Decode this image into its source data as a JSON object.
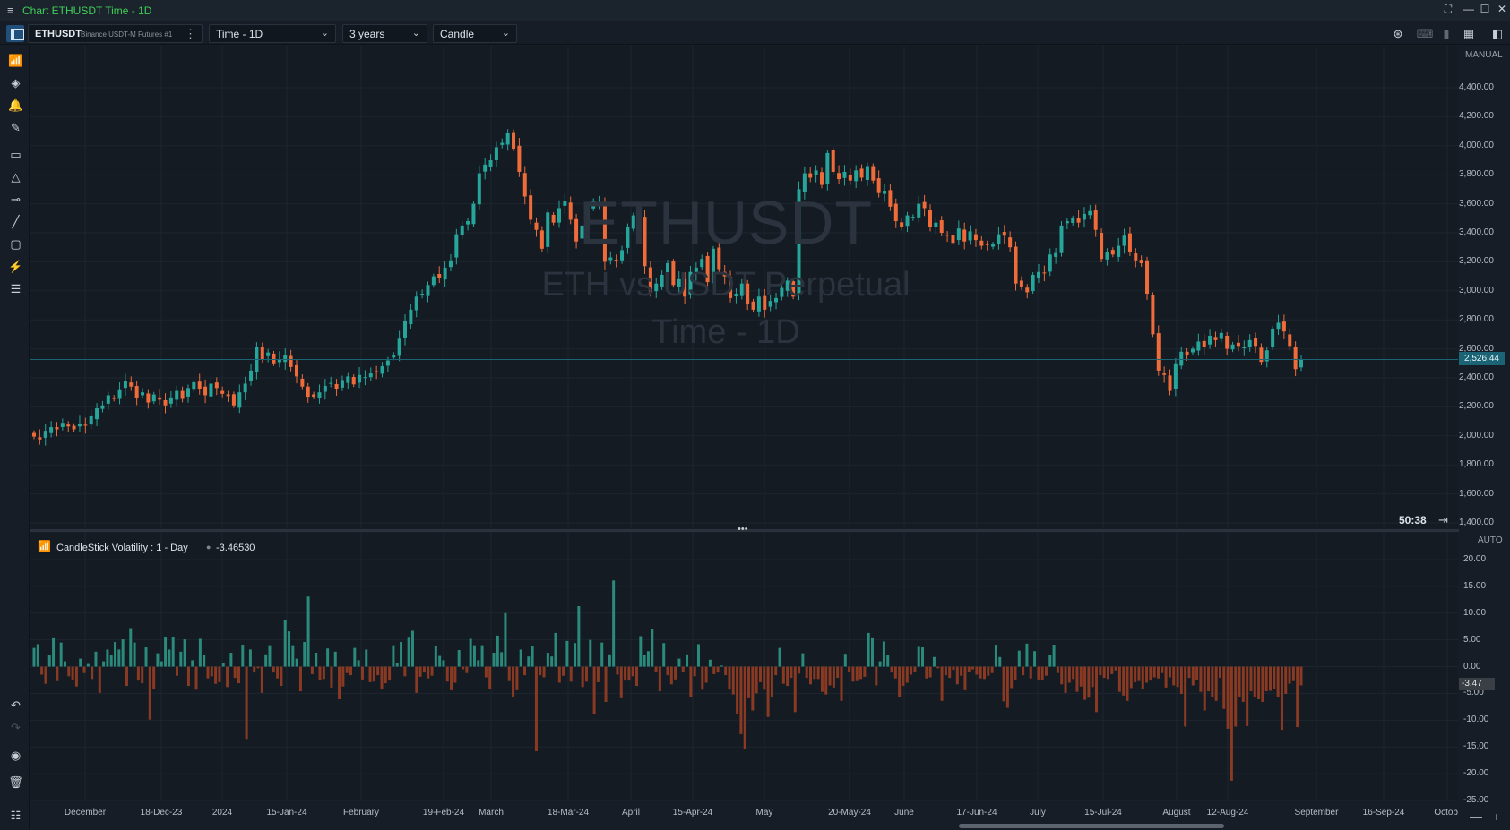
{
  "window": {
    "menu_icon": "hamburger-icon",
    "title": "Chart ETHUSDT Time - 1D",
    "buttons": [
      "fullscreen-icon",
      "minimize-icon",
      "maximize-icon",
      "close-icon"
    ]
  },
  "toolbar": {
    "symbol": "ETHUSDT",
    "exchange": "Binance USDT-M Futures #1",
    "timeframe": "Time - 1D",
    "range": "3 years",
    "chart_type": "Candle"
  },
  "watermark": {
    "symbol": "ETHUSDT",
    "description": "ETH vs USDT Perpetual",
    "timeframe": "Time - 1D"
  },
  "price_axis": {
    "mode": "MANUAL",
    "labels": [
      "4,400.00",
      "4,200.00",
      "4,000.00",
      "3,800.00",
      "3,600.00",
      "3,400.00",
      "3,200.00",
      "3,000.00",
      "2,800.00",
      "2,600.00",
      "2,400.00",
      "2,200.00",
      "2,000.00",
      "1,800.00",
      "1,600.00",
      "1,400.00"
    ],
    "current_price": "2,526.44",
    "countdown": "50:38"
  },
  "indicator": {
    "name": "CandleStick Volatility : 1 - Day",
    "value": "-3.46530",
    "axis_mode": "AUTO",
    "axis_labels": [
      "20.00",
      "15.00",
      "10.00",
      "5.00",
      "0.00",
      "-5.00",
      "-10.00",
      "-15.00",
      "-20.00",
      "-25.00"
    ],
    "current_value": "-3.47"
  },
  "time_axis": {
    "labels": [
      "December",
      "18-Dec-23",
      "2024",
      "15-Jan-24",
      "February",
      "19-Feb-24",
      "March",
      "18-Mar-24",
      "April",
      "15-Apr-24",
      "May",
      "20-May-24",
      "June",
      "17-Jun-24",
      "July",
      "15-Jul-24",
      "August",
      "12-Aug-24",
      "September",
      "16-Sep-24",
      "Octob"
    ]
  },
  "colors": {
    "background": "#141b23",
    "grid": "#1c252f",
    "up": "#26a69a",
    "down": "#ef6c3a",
    "vol_up": "#2a8a7c",
    "vol_down": "#8a3a22",
    "price_line": "#1b6476"
  },
  "chart_data": [
    {
      "type": "candlestick",
      "title": "ETHUSDT",
      "ylim": [
        1400,
        4400
      ],
      "series": [
        {
          "name": "ETHUSDT",
          "close": [
            1995,
            1975,
            2035,
            2060,
            2045,
            2090,
            2065,
            2045,
            2085,
            2070,
            2135,
            2190,
            2210,
            2280,
            2255,
            2315,
            2380,
            2340,
            2260,
            2300,
            2230,
            2285,
            2250,
            2210,
            2265,
            2310,
            2255,
            2330,
            2370,
            2320,
            2280,
            2360,
            2330,
            2290,
            2275,
            2210,
            2300,
            2360,
            2450,
            2610,
            2530,
            2575,
            2500,
            2530,
            2555,
            2475,
            2410,
            2340,
            2270,
            2270,
            2300,
            2345,
            2365,
            2325,
            2385,
            2410,
            2355,
            2420,
            2405,
            2430,
            2440,
            2480,
            2520,
            2560,
            2670,
            2790,
            2870,
            2960,
            2980,
            3040,
            3100,
            3090,
            3160,
            3210,
            3390,
            3450,
            3480,
            3600,
            3810,
            3870,
            3900,
            3990,
            4020,
            4090,
            3980,
            3820,
            3650,
            3490,
            3420,
            3290,
            3540,
            3470,
            3570,
            3620,
            3490,
            3340,
            3450,
            3560,
            3620,
            3600,
            3200,
            3230,
            3210,
            3280,
            3440,
            3520,
            3490,
            3170,
            2990,
            3050,
            3110,
            3190,
            3040,
            3080,
            2960,
            3130,
            3160,
            3220,
            3060,
            3290,
            3150,
            3100,
            2950,
            2980,
            3050,
            2910,
            2870,
            2960,
            2870,
            2930,
            2950,
            3020,
            3070,
            2960,
            3700,
            3810,
            3780,
            3830,
            3730,
            3950,
            3820,
            3770,
            3820,
            3760,
            3830,
            3780,
            3860,
            3760,
            3680,
            3690,
            3580,
            3480,
            3440,
            3520,
            3510,
            3600,
            3570,
            3440,
            3470,
            3400,
            3380,
            3330,
            3430,
            3340,
            3410,
            3350,
            3310,
            3320,
            3320,
            3390,
            3380,
            3300,
            3050,
            3030,
            2990,
            3110,
            3130,
            3120,
            3250,
            3260,
            3450,
            3480,
            3500,
            3470,
            3530,
            3550,
            3420,
            3220,
            3270,
            3250,
            3310,
            3380,
            3270,
            3210,
            3190,
            2980,
            2700,
            2450,
            2420,
            2310,
            2500,
            2580,
            2560,
            2600,
            2650,
            2610,
            2690,
            2660,
            2710,
            2600,
            2630,
            2620,
            2610,
            2660,
            2620,
            2510,
            2590,
            2740,
            2780,
            2720,
            2620,
            2460,
            2530
          ]
        }
      ]
    },
    {
      "type": "bar",
      "title": "CandleStick Volatility : 1 - Day",
      "ylim": [
        -25,
        22
      ],
      "series": [
        {
          "name": "CandleStick Volatility",
          "values": [
            3.5,
            4.2,
            -1.5,
            -3.2,
            2.1,
            5.3,
            -2.7,
            4.5,
            1.0,
            -1.8,
            -2.4,
            -3.7,
            1.5,
            -1.2,
            0.5,
            -2.3,
            2.8,
            -4.9,
            1.0,
            3.2,
            2.1,
            4.6,
            3.2,
            5.1,
            -3.6,
            7.2,
            4.5,
            -2.6,
            -3.1,
            3.6,
            -9.9,
            -4.1,
            2.5,
            1.0,
            5.6,
            3.2,
            5.6,
            -1.7,
            2.8,
            5.1,
            -3.6,
            1.2,
            -4.3,
            5.2,
            2.2,
            -2.2,
            -1.8,
            -3.2,
            -2.9,
            0.6,
            -3.8,
            2.6,
            -2.1,
            -3.1,
            4.1,
            -13.5,
            3.2,
            -1.1,
            -0.3,
            -4.9,
            2.3,
            4.0,
            -1.1,
            -2.2,
            -3.6,
            8.7,
            6.6,
            4.0,
            1.5,
            -4.6,
            4.6,
            13.1,
            -1.4,
            2.6,
            -2.6,
            -2.3,
            3.4,
            -3.9,
            2.8,
            -6.1,
            -3.7,
            -1.2,
            -1.6,
            3.5,
            1.2,
            -2.4,
            3.2,
            -2.9,
            -2.8,
            -1.6,
            -4.2,
            -3.1,
            -2.6,
            4.0,
            0.6,
            4.6,
            -1.8,
            5.4,
            6.7,
            -4.9,
            -1.9,
            -1.1,
            -2.2,
            -1.7,
            3.8,
            2.0,
            1.2,
            -2.8,
            -4.4,
            -3.0,
            3.1,
            -0.5,
            -1.2,
            5.2,
            4.0,
            1.2,
            4.0,
            -2.0,
            -4.2,
            2.6,
            5.8,
            2.7,
            10.0,
            -2.7,
            -5.6,
            -4.4,
            3.2,
            -1.6,
            1.9,
            3.8,
            -15.8,
            -1.6,
            -2.0,
            2.6,
            1.9,
            6.3,
            -3.0,
            -1.7,
            4.8,
            -2.8,
            4.4,
            11.3,
            -3.8,
            -2.8,
            5.0,
            -8.9,
            -2.9,
            4.5,
            -6.6,
            2.3,
            16.1,
            -1.5,
            -5.9,
            -2.6,
            -2.6,
            -1.8,
            -3.6,
            5.7,
            2.1,
            2.9,
            7.0,
            -0.9,
            -4.6,
            4.4,
            -1.6,
            -3.3,
            -2.4,
            1.5,
            -1.0,
            2.3,
            -5.7,
            -1.8,
            4.2,
            -4.3,
            -3.0,
            1.3,
            -1.4,
            -1.1,
            0.2,
            -1.6,
            -4.3,
            -5.2,
            -8.9,
            -12.6,
            -15.3,
            -5.9,
            -8.2,
            -5.0,
            -2.9,
            -4.3,
            -9.4,
            -5.7,
            -1.6,
            3.5,
            -3.2,
            -3.6,
            -2.1,
            -8.5,
            -1.3,
            2.5,
            -2.1,
            -3.3,
            -2.3,
            -2.3,
            -4.7,
            -5.2,
            -3.5,
            -3.9,
            -2.1,
            -6.4,
            2.4,
            -0.9,
            -2.8,
            -2.7,
            -2.3,
            -1.9,
            6.3,
            5.3,
            -3.5,
            1.0,
            4.7,
            2.2,
            -1.1,
            -2.2,
            -5.6,
            -3.6,
            -3.0,
            -1.5,
            -1.0,
            3.7,
            3.6,
            -2.2,
            -2.0,
            1.8,
            -0.3,
            -6.4,
            -1.6,
            -2.1,
            -0.6,
            -3.3,
            -1.7,
            -4.4,
            -0.9,
            -0.5,
            -1.5,
            -2.2,
            -2.3,
            -1.7,
            -1.2,
            4.1,
            1.8,
            -6.5,
            -7.7,
            -4.0,
            -2.5,
            3.0,
            -1.6,
            4.3,
            -2.2,
            2.9,
            -2.4,
            -2.5,
            -1.7,
            2.1,
            4.1,
            -1.2,
            -3.3,
            -4.9,
            -3.0,
            -2.3,
            -4.7,
            -3.7,
            -6.2,
            -5.8,
            -3.8,
            -8.5,
            -1.6,
            -2.1,
            -2.3,
            -1.4,
            -0.7,
            -4.7,
            -5.4,
            -6.4,
            -4.0,
            -2.9,
            -2.7,
            -4.1,
            -3.0,
            -2.6,
            -2.0,
            -2.2,
            -1.2,
            -3.9,
            -2.0,
            -3.5,
            -3.8,
            -5.1,
            -11.2,
            -2.1,
            -3.5,
            -2.5,
            -4.7,
            -8.2,
            -4.6,
            -5.7,
            -6.4,
            -2.1,
            -7.9,
            -11.6,
            -21.3,
            -11.2,
            -5.6,
            -6.6,
            -11.1,
            -4.6,
            -5.7,
            -6.1,
            -6.6,
            -4.6,
            -4.5,
            -4.1,
            -5.6,
            -11.8,
            -5.1,
            -3.2,
            -2.7,
            -11.3,
            -3.5
          ]
        }
      ]
    }
  ]
}
